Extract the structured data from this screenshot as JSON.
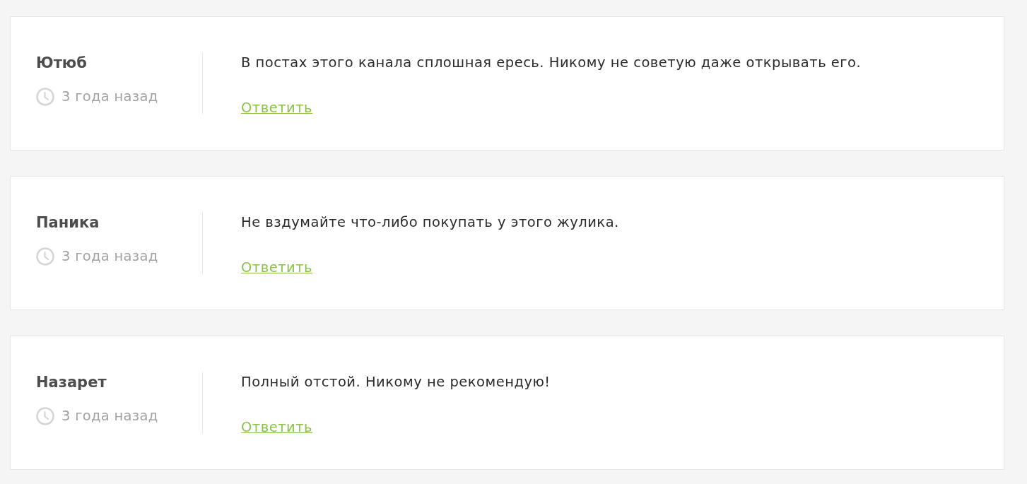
{
  "comments": [
    {
      "author": "Ютюб",
      "time": "3 года назад",
      "text": "В постах этого канала сплошная ересь. Никому не советую даже открывать его.",
      "reply": "Ответить"
    },
    {
      "author": "Паника",
      "time": "3 года назад",
      "text": "Не вздумайте что-либо покупать у этого жулика.",
      "reply": "Ответить"
    },
    {
      "author": "Назарет",
      "time": "3 года назад",
      "text": "Полный отстой. Никому не рекомендую!",
      "reply": "Ответить"
    }
  ]
}
